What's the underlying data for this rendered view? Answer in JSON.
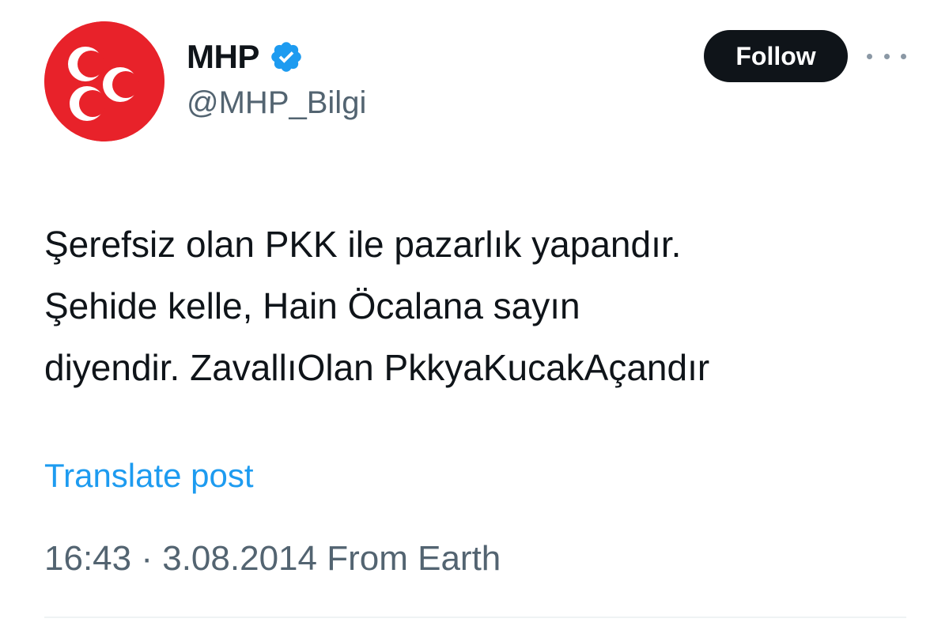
{
  "author": {
    "display_name": "MHP",
    "handle": "@MHP_Bilgi",
    "verified": true,
    "avatar_icon": "crescents-logo",
    "avatar_color": "#e8222a",
    "verified_color": "#1d9bf0"
  },
  "actions": {
    "follow_label": "Follow",
    "more_icon": "more-horizontal-icon"
  },
  "post": {
    "lines": [
      "Şerefsiz olan PKK ile pazarlık yapandır.",
      "Şehide kelle, Hain Öcalana sayın",
      "diyendir. ZavallıOlan PkkyaKucakAçandır"
    ],
    "translate_label": "Translate post",
    "time": "16:43",
    "separator": "·",
    "date": "3.08.2014",
    "source": "From Earth"
  }
}
